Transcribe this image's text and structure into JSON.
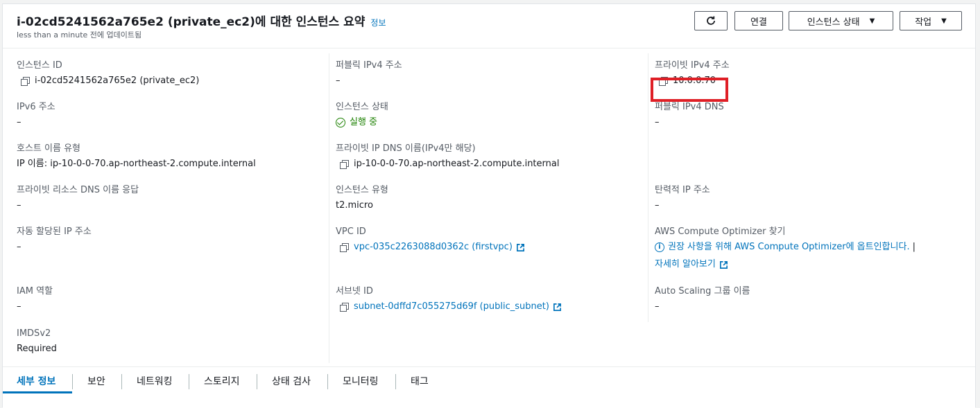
{
  "header": {
    "title": "i-02cd5241562a765e2 (private_ec2)에 대한 인스턴스 요약",
    "info_link": "정보",
    "subtitle": "less than a minute 전에 업데이트됨",
    "connect_label": "연결",
    "instance_state_label": "인스턴스 상태",
    "actions_label": "작업"
  },
  "details": {
    "instance_id_label": "인스턴스 ID",
    "instance_id_value": "i-02cd5241562a765e2 (private_ec2)",
    "ipv6_label": "IPv6 주소",
    "ipv6_value": "–",
    "hostname_type_label": "호스트 이름 유형",
    "hostname_type_value": "IP 이름: ip-10-0-0-70.ap-northeast-2.compute.internal",
    "private_dns_answer_label": "프라이빗 리소스 DNS 이름 응답",
    "private_dns_answer_value": "–",
    "auto_ip_label": "자동 할당된 IP 주소",
    "auto_ip_value": "–",
    "iam_label": "IAM 역할",
    "iam_value": "–",
    "imds_label": "IMDSv2",
    "imds_value": "Required",
    "public_ipv4_label": "퍼블릭 IPv4 주소",
    "public_ipv4_value": "–",
    "instance_state_label": "인스턴스 상태",
    "instance_state_value": "실행 중",
    "private_dns_label": "프라이빗 IP DNS 이름(IPv4만 해당)",
    "private_dns_value": "ip-10-0-0-70.ap-northeast-2.compute.internal",
    "instance_type_label": "인스턴스 유형",
    "instance_type_value": "t2.micro",
    "vpc_label": "VPC ID",
    "vpc_value": "vpc-035c2263088d0362c (firstvpc)",
    "subnet_label": "서브넷 ID",
    "subnet_value": "subnet-0dffd7c055275d69f (public_subnet)",
    "private_ipv4_label": "프라이빗 IPv4 주소",
    "private_ipv4_value": "10.0.0.70",
    "public_dns_label": "퍼블릭 IPv4 DNS",
    "public_dns_value": "–",
    "elastic_ip_label": "탄력적 IP 주소",
    "elastic_ip_value": "–",
    "optimizer_label": "AWS Compute Optimizer 찾기",
    "optimizer_value": "권장 사항을 위해 AWS Compute Optimizer에 옵트인합니다.",
    "optimizer_sep": "|",
    "optimizer_learn_more": "자세히 알아보기",
    "asg_label": "Auto Scaling 그룹 이름",
    "asg_value": "–"
  },
  "tabs": [
    "세부 정보",
    "보안",
    "네트워킹",
    "스토리지",
    "상태 검사",
    "모니터링",
    "태그"
  ],
  "colors": {
    "link": "#0073bb",
    "running": "#1d8102",
    "highlight": "#df1f26"
  }
}
